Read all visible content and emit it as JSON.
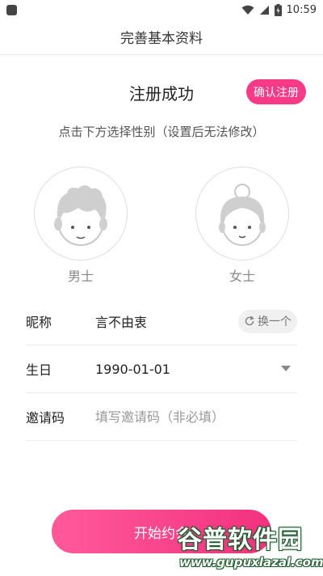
{
  "status_bar": {
    "time": "10:59"
  },
  "header": {
    "title": "完善基本资料"
  },
  "registration": {
    "title": "注册成功",
    "confirm_button": "确认注册",
    "hint": "点击下方选择性别（设置后无法修改）"
  },
  "gender": {
    "male_label": "男士",
    "female_label": "女士"
  },
  "form": {
    "nickname": {
      "label": "昵称",
      "value": "言不由衷",
      "change_button": "换一个"
    },
    "birthday": {
      "label": "生日",
      "value": "1990-01-01"
    },
    "invite_code": {
      "label": "邀请码",
      "placeholder": "填写邀请码（非必填）"
    }
  },
  "start_button": "开始约会",
  "watermark": {
    "title": "谷普软件园",
    "url": "www.gupuxlazal.com"
  },
  "colors": {
    "accent": "#f63a87",
    "avatar_gray": "#cccccc"
  }
}
